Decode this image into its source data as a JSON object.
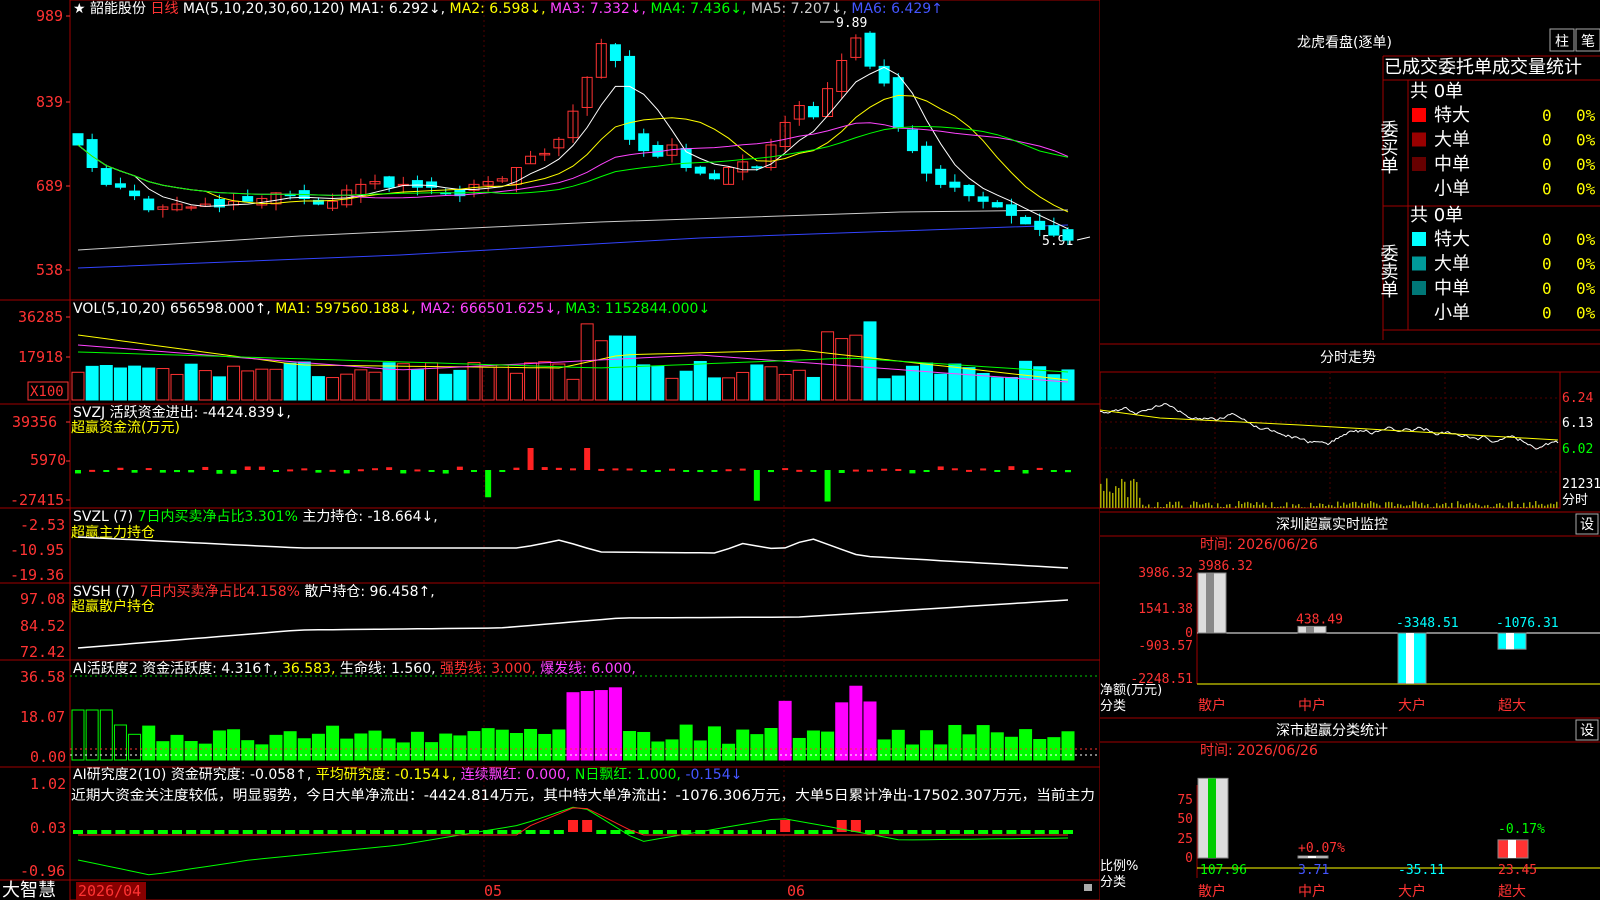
{
  "window": {
    "app_name": "大智慧",
    "price_ticks": [
      "989",
      "839",
      "689",
      "538"
    ],
    "vol_ticks": [
      "36285",
      "17918"
    ],
    "vol_unit": "X100",
    "svzj_ticks": [
      "39356",
      "5970",
      "-27415"
    ],
    "svzl_ticks": [
      "-2.53",
      "-10.95",
      "-19.36"
    ],
    "svsh_ticks": [
      "97.08",
      "84.52",
      "72.42"
    ],
    "ai2_ticks": [
      "36.58",
      "18.07",
      "0.00"
    ],
    "ai3_ticks": [
      "1.02",
      "0.03",
      "-0.96"
    ],
    "date_axis": [
      "2026/04",
      "05",
      "06"
    ]
  },
  "price_header": {
    "star": "★",
    "name": "韶能股份",
    "period": "日线",
    "ma_params": "MA(5,10,20,30,60,120)",
    "ma1": "MA1: 6.292↓,",
    "ma2": "MA2: 6.598↓,",
    "ma3": "MA3: 7.332↓,",
    "ma4": "MA4: 7.436↓,",
    "ma5": "MA5: 7.207↓,",
    "ma6": "MA6: 6.429↑",
    "high_label": "9.89",
    "low_label": "5.91"
  },
  "vol_header": {
    "name": "VOL(5,10,20)",
    "value": "656598.000↑,",
    "ma1": "MA1: 597560.188↓,",
    "ma2": "MA2: 666501.625↓,",
    "ma3": "MA3: 1152844.000↓"
  },
  "svzj_header": {
    "name": "SVZJ",
    "value": "活跃资金进出: -4424.839↓,",
    "sub": "超赢资金流(万元)"
  },
  "svzl_header": {
    "name": "SVZL (7)",
    "ratio": "7日内买卖净占比3.301%",
    "value": "主力持仓: -18.664↓,",
    "sub": "超赢主力持仓"
  },
  "svsh_header": {
    "name": "SVSH (7)",
    "ratio": "7日内买卖净占比4.158%",
    "value": "散户持仓: 96.458↑,",
    "sub": "超赢散户持仓"
  },
  "ai2_header": {
    "name": "AI活跃度2",
    "v1": "资金活跃度: 4.316↑,",
    "v2": "36.583,",
    "v3": "生命线: 1.560,",
    "v4": "强势线: 3.000,",
    "v5": "爆发线: 6.000,"
  },
  "ai3_header": {
    "name": "AI研究度2(10)",
    "v1": "资金研究度: -0.058↑,",
    "v2": "平均研究度: -0.154↓,",
    "v3": "连续飘红: 0.000,",
    "v4": "N日飘红: 1.000,",
    "v5": "-0.154↓",
    "text": "近期大资金关注度较低，明显弱势，今日大单净流出：-4424.814万元，其中特大单净流出：-1076.306万元，大单5日累计净出-17502.307万元，当前主力"
  },
  "lhb": {
    "title": "龙虎看盘(逐单)",
    "btn_zhu": "柱",
    "btn_bi": "笔",
    "header": "已成交委托单成交量统计",
    "buy": {
      "side": "委买单",
      "total": "共 0单",
      "rows": [
        {
          "label": "特大",
          "count": "0",
          "pct": "0%",
          "color": "#ff0000"
        },
        {
          "label": "大单",
          "count": "0",
          "pct": "0%",
          "color": "#990000"
        },
        {
          "label": "中单",
          "count": "0",
          "pct": "0%",
          "color": "#660000"
        },
        {
          "label": "小单",
          "count": "0",
          "pct": "0%",
          "color": ""
        }
      ]
    },
    "sell": {
      "side": "委卖单",
      "total": "共 0单",
      "rows": [
        {
          "label": "特大",
          "count": "0",
          "pct": "0%",
          "color": "#00ffff"
        },
        {
          "label": "大单",
          "count": "0",
          "pct": "0%",
          "color": "#009999"
        },
        {
          "label": "中单",
          "count": "0",
          "pct": "0%",
          "color": "#007777"
        },
        {
          "label": "小单",
          "count": "0",
          "pct": "0%",
          "color": ""
        }
      ]
    }
  },
  "fenshi": {
    "title": "分时走势",
    "ticks": [
      "6.24",
      "6.13",
      "6.02"
    ],
    "vol_tick": "21231",
    "unit": "分时"
  },
  "monitor": {
    "title": "深圳超赢实时监控",
    "btn": "设",
    "time": "时间: 2026/06/26",
    "ticks": [
      "3986.32",
      "1541.38",
      "0",
      "-903.57",
      "-2248.51"
    ],
    "ylabel": "净额(万元)",
    "xlabel": "分类",
    "categories": [
      "散户",
      "中户",
      "大户",
      "超大"
    ],
    "value_labels": [
      "3986.32",
      "438.49",
      "-3348.51",
      "-1076.31"
    ]
  },
  "classify": {
    "title": "深市超赢分类统计",
    "btn": "设",
    "time": "时间: 2026/06/26",
    "ticks": [
      "75",
      "50",
      "25",
      "0"
    ],
    "ylabel": "比例%",
    "xlabel": "分类",
    "categories": [
      "散户",
      "中户",
      "大户",
      "超大"
    ],
    "top_labels": [
      "+0.07%",
      "-0.17%"
    ],
    "bottom_labels": [
      "107.96",
      "3.71",
      "-35.11",
      "23.45"
    ]
  },
  "chart_data": [
    {
      "type": "bar",
      "title": "深圳超赢实时监控",
      "ylabel": "净额(万元)",
      "xlabel": "分类",
      "categories": [
        "散户",
        "中户",
        "大户",
        "超大"
      ],
      "values": [
        3986.32,
        438.49,
        -3348.51,
        -1076.31
      ],
      "ylim": [
        -3350,
        3986.32
      ],
      "colors": [
        "#ffffff",
        "#ffffff",
        "#00ffff",
        "#00ffff"
      ]
    },
    {
      "type": "bar",
      "title": "深市超赢分类统计",
      "ylabel": "比例%",
      "xlabel": "分类",
      "categories": [
        "散户",
        "中户",
        "大户",
        "超大"
      ],
      "values": [
        107.96,
        3.71,
        -35.11,
        23.45
      ],
      "ylim": [
        0,
        75
      ],
      "colors": [
        "#ffffff",
        "#ffffff",
        "#00ffff",
        "#ff4444"
      ]
    }
  ]
}
